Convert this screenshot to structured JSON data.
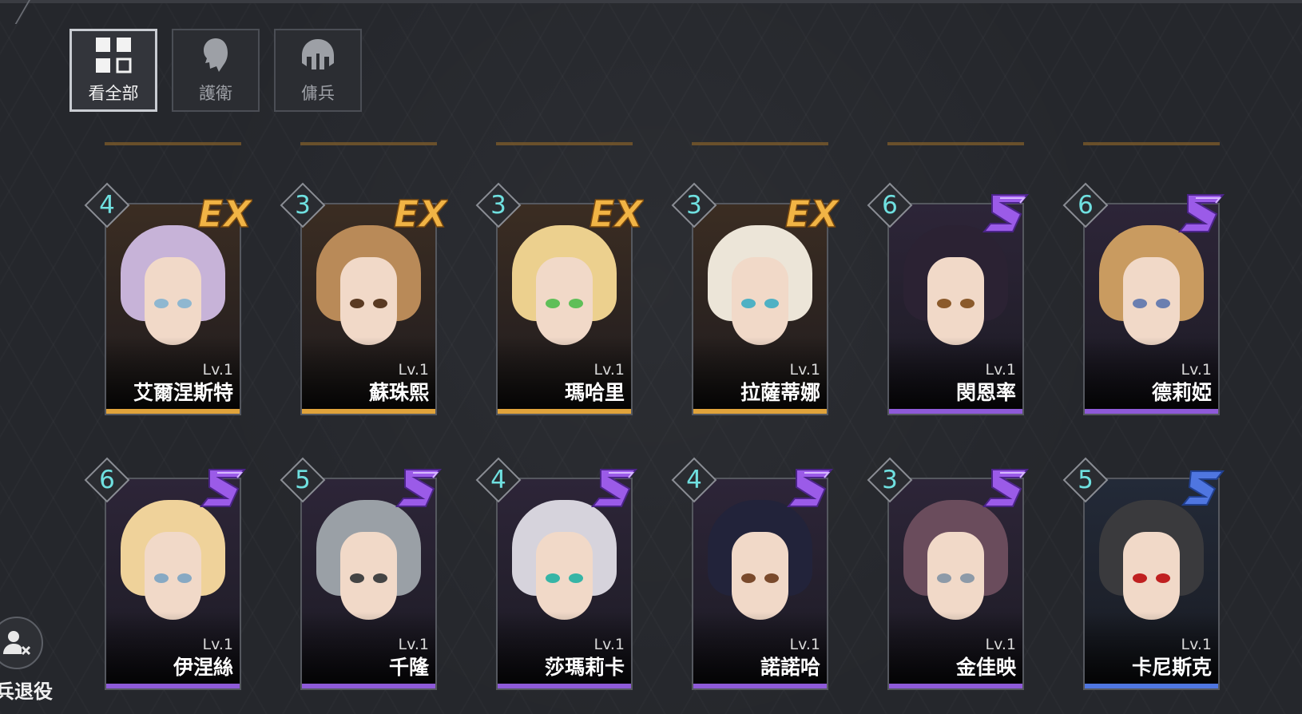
{
  "filters": [
    {
      "label": "看全部",
      "icon": "grid-icon",
      "active": true
    },
    {
      "label": "護衛",
      "icon": "head-profile-icon",
      "active": false
    },
    {
      "label": "傭兵",
      "icon": "helmet-icon",
      "active": false
    }
  ],
  "cards": [
    {
      "stars": "4",
      "rank": "EX",
      "level": "Lv.1",
      "name": "艾爾涅斯特",
      "hair": "#c7b3d8",
      "eye": "#8fb7d0"
    },
    {
      "stars": "3",
      "rank": "EX",
      "level": "Lv.1",
      "name": "蘇珠熙",
      "hair": "#b98a58",
      "eye": "#5a3a22"
    },
    {
      "stars": "3",
      "rank": "EX",
      "level": "Lv.1",
      "name": "瑪哈里",
      "hair": "#ecd08e",
      "eye": "#5fbf58"
    },
    {
      "stars": "3",
      "rank": "EX",
      "level": "Lv.1",
      "name": "拉薩蒂娜",
      "hair": "#ece5d8",
      "eye": "#4fb1c4"
    },
    {
      "stars": "6",
      "rank": "SS",
      "level": "Lv.1",
      "name": "閔恩率",
      "hair": "#2b2233",
      "eye": "#8b5a2b"
    },
    {
      "stars": "6",
      "rank": "SS",
      "level": "Lv.1",
      "name": "德莉婭",
      "hair": "#c99b60",
      "eye": "#6b7fb0"
    },
    {
      "stars": "6",
      "rank": "SS",
      "level": "Lv.1",
      "name": "伊涅絲",
      "hair": "#efd29a",
      "eye": "#87a9c3"
    },
    {
      "stars": "5",
      "rank": "SS",
      "level": "Lv.1",
      "name": "千隆",
      "hair": "#9aa0a6",
      "eye": "#444"
    },
    {
      "stars": "4",
      "rank": "SS",
      "level": "Lv.1",
      "name": "莎瑪莉卡",
      "hair": "#d6d3dc",
      "eye": "#36b5a6"
    },
    {
      "stars": "4",
      "rank": "SS",
      "level": "Lv.1",
      "name": "諾諾哈",
      "hair": "#22233a",
      "eye": "#7a4a2c"
    },
    {
      "stars": "3",
      "rank": "SS",
      "level": "Lv.1",
      "name": "金佳映",
      "hair": "#6a4c5c",
      "eye": "#8d9aa8"
    },
    {
      "stars": "5",
      "rank": "S",
      "level": "Lv.1",
      "name": "卡尼斯克",
      "hair": "#3a3a3d",
      "eye": "#c02020"
    }
  ],
  "retire": {
    "label": "兵退役",
    "icon": "user-remove-icon"
  },
  "colors": {
    "ex": "#e0a33b",
    "ss": "#8e5ad8",
    "s": "#4f76e0",
    "star_number": "#6fe0e0"
  }
}
